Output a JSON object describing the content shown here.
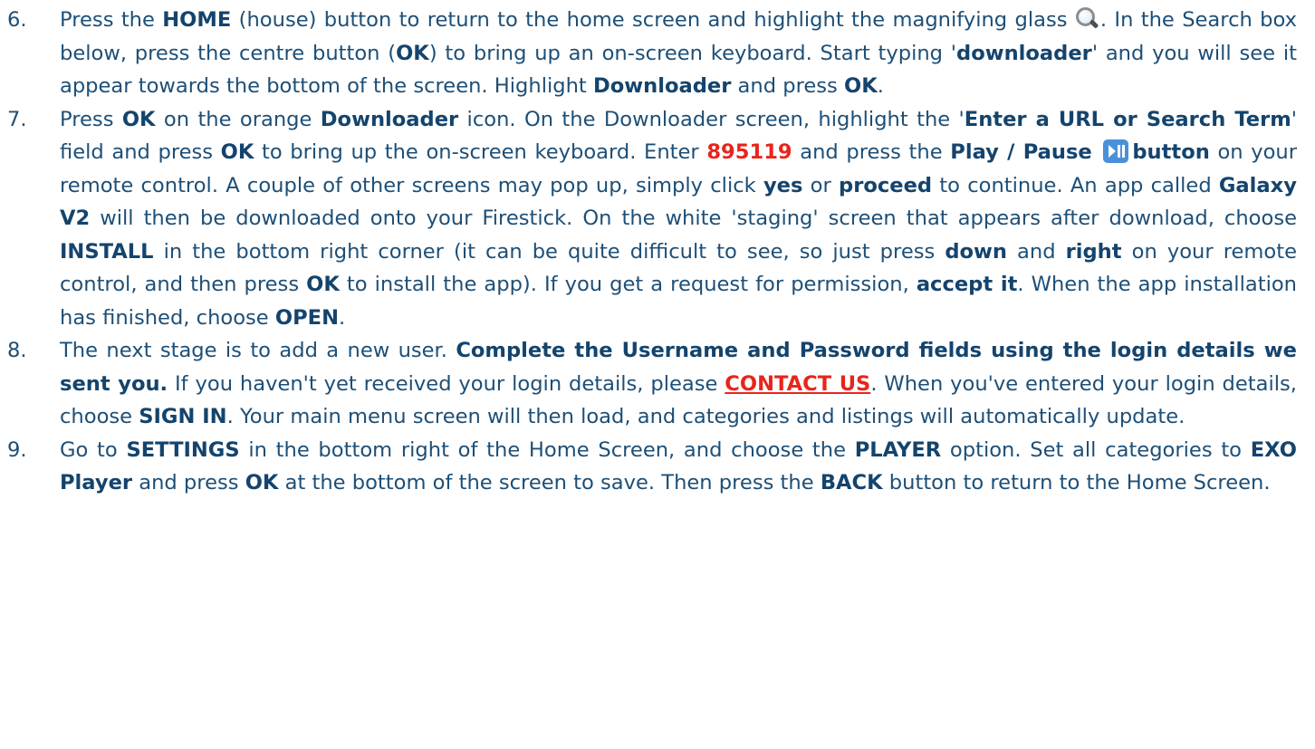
{
  "steps": [
    {
      "number": "6.",
      "parts": {
        "p1": "Press the ",
        "b1": "HOME",
        "p2": " (house) button to return to the home screen and highlight the magnifying glass ",
        "p3": ". In the Search box below, press the centre button (",
        "b2": "OK",
        "p4": ") to bring up an on-screen keyboard. Start typing '",
        "b3": "downloader",
        "p5": "' and you will see it appear towards the bottom of the screen. Highlight ",
        "b4": "Downloader",
        "p6": " and press ",
        "b5": "OK",
        "p7": "."
      }
    },
    {
      "number": "7.",
      "parts": {
        "p1": "Press ",
        "b1": "OK",
        "p2": " on the orange ",
        "b2": "Downloader",
        "p3": " icon. On the Downloader screen, highlight the '",
        "b3": "Enter a URL or Search Term",
        "p4": "' field and press ",
        "b4": "OK",
        "p5": " to bring up the on-screen keyboard. Enter ",
        "r1": "895119",
        "p6": " and press the ",
        "b5": "Play / Pause",
        "p7": " ",
        "b6": "button",
        "p8": " on your remote control. A couple of other screens may pop up, simply click ",
        "b7": "yes",
        "p9": " or ",
        "b8": "proceed",
        "p10": " to continue. An app called ",
        "b9": "Galaxy V2",
        "p11": " will then be downloaded onto your Firestick. On the white 'staging' screen that appears after download, choose ",
        "b10": "INSTALL",
        "p12": " in the bottom right corner (it can be quite difficult to see, so just press ",
        "b11": "down",
        "p13": " and ",
        "b12": "right",
        "p14": " on your remote control, and then press ",
        "b13": "OK",
        "p15": " to install the app). If you get a request for permission, ",
        "b14": "accept it",
        "p16": ". When the app installation has finished, choose ",
        "b15": "OPEN",
        "p17": "."
      }
    },
    {
      "number": "8.",
      "parts": {
        "p1": "The next stage is to add a new user. ",
        "b1": "Complete the Username and Password fields using the login details we sent you.",
        "p2": " If you haven't yet received your login details, please ",
        "l1": "CONTACT US",
        "p3": ". When you've entered your login details, choose ",
        "b2": "SIGN IN",
        "p4": ". Your main menu screen will then load, and categories and listings will automatically update."
      }
    },
    {
      "number": "9.",
      "parts": {
        "p1": "Go to ",
        "b1": "SETTINGS",
        "p2": " in the bottom right of the Home Screen, and choose the ",
        "b2": "PLAYER",
        "p3": " option. Set all categories to ",
        "b3": "EXO Player",
        "p4": " and press ",
        "b4": "OK",
        "p5": " at the bottom of the screen to save. Then press the ",
        "b5": "BACK",
        "p6": " button to return to the Home Screen."
      }
    }
  ],
  "icons": {
    "magnifier": "magnifying-glass-icon",
    "play_pause": "play-pause-icon"
  },
  "colors": {
    "text": "#1d4f77",
    "bold_text": "#14446d",
    "accent_red": "#e8251b",
    "play_pause_bg": "#4a90d9"
  }
}
